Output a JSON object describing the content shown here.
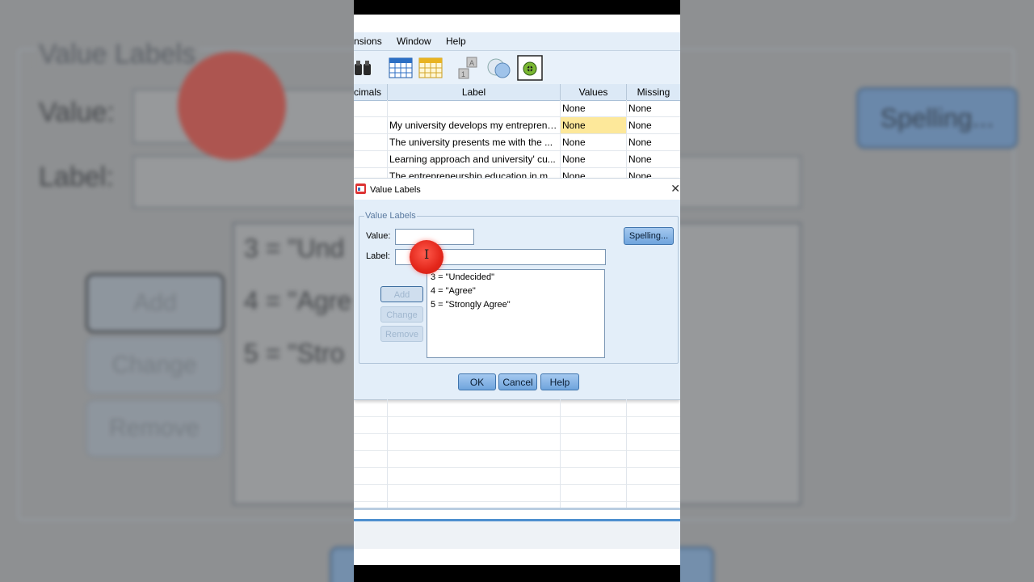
{
  "background": {
    "title": "Value Labels",
    "value_label": "Value:",
    "label_label": "Label:",
    "items": [
      "3 = \"Und",
      "4 = \"Agre",
      "5 = \"Stro"
    ],
    "add": "Add",
    "change": "Change",
    "remove": "Remove",
    "spelling": "Spelling..."
  },
  "menubar": {
    "items": [
      "nsions",
      "Window",
      "Help"
    ]
  },
  "toolbar": {
    "icons": [
      "find-icon",
      "go-to-case-icon",
      "go-to-variable-icon",
      "value-labels-icon",
      "use-sets-icon",
      "add-on-icon"
    ]
  },
  "grid": {
    "columns": [
      "cimals",
      "Label",
      "Values",
      "Missing"
    ],
    "rows": [
      {
        "label": "",
        "values": "None",
        "missing": "None"
      },
      {
        "label": "My university develops my entrepreneurial...",
        "values": "None",
        "missing": "None"
      },
      {
        "label": "The university presents me with the ...",
        "values": "None",
        "missing": "None"
      },
      {
        "label": "Learning approach and university' cu...",
        "values": "None",
        "missing": "None"
      },
      {
        "label": "The entrepreneurship education in m...",
        "values": "None",
        "missing": "None"
      }
    ]
  },
  "dialog": {
    "title": "Value Labels",
    "group_title": "Value Labels",
    "value_label": "Value:",
    "value": "",
    "label_label": "Label:",
    "label": "",
    "spelling": "Spelling...",
    "list": [
      "3 = \"Undecided\"",
      "4 = \"Agree\"",
      "5 = \"Strongly Agree\""
    ],
    "add": "Add",
    "change": "Change",
    "remove": "Remove",
    "ok": "OK",
    "cancel": "Cancel",
    "help": "Help"
  },
  "colors": {
    "accent": "#6fa4dd",
    "highlight": "#fde89a",
    "cursor": "#e3261a"
  }
}
